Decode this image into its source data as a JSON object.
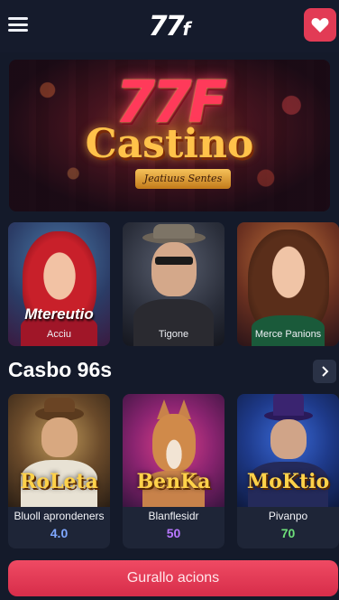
{
  "header": {
    "logo_main": "77",
    "logo_suffix": "f",
    "menu_icon": "hamburger-menu-icon",
    "favorite_icon": "heart-icon"
  },
  "hero": {
    "number": "77F",
    "title": "Castino",
    "subtitle": "Jeatiuus Sentes"
  },
  "featured": [
    {
      "name": "Mtereutio",
      "caption": "Acciu"
    },
    {
      "name": "",
      "caption": "Tigone"
    },
    {
      "name": "",
      "caption": "Merce Panions"
    }
  ],
  "section": {
    "title": "Casbo 96s",
    "arrow_icon": "chevron-right-icon"
  },
  "games": [
    {
      "title": "RoLeta",
      "label": "Bluoll aprondeners",
      "value": "4.0",
      "value_color": "#7fa8ff"
    },
    {
      "title": "BenKa",
      "label": "Blanflesidr",
      "value": "50",
      "value_color": "#b878ff"
    },
    {
      "title": "MoKtio",
      "label": "Pivanpo",
      "value": "70",
      "value_color": "#6ee07a"
    }
  ],
  "cta": {
    "label": "Gurallo acions"
  },
  "colors": {
    "background": "#141a2a",
    "accent": "#e23b55",
    "card": "#1e2537"
  }
}
